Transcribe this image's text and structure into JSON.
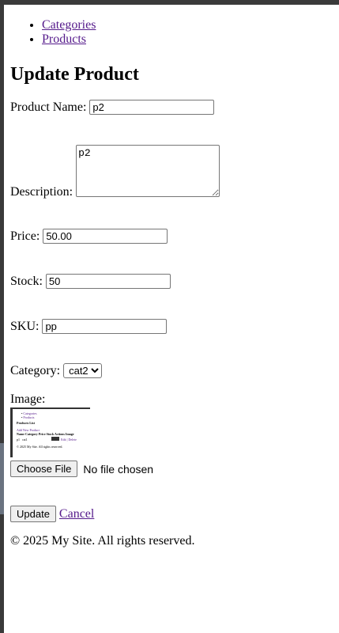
{
  "nav": {
    "items": [
      "Categories",
      "Products"
    ]
  },
  "form": {
    "title": "Update Product",
    "product_name": {
      "label": "Product Name:",
      "value": "p2"
    },
    "description": {
      "label": "Description:",
      "value": "p2"
    },
    "price": {
      "label": "Price:",
      "value": "50.00"
    },
    "stock": {
      "label": "Stock:",
      "value": "50"
    },
    "sku": {
      "label": "SKU:",
      "value": "pp"
    },
    "category": {
      "label": "Category:",
      "selected": "cat2"
    },
    "image": {
      "label": "Image:",
      "thumbnail": {
        "nav": [
          "Categories",
          "Products"
        ],
        "title": "Products List",
        "add_link": "Add New Product",
        "headers": [
          "Name",
          "Category",
          "Price",
          "Stock",
          "Actions",
          "Image"
        ],
        "row": [
          "p1",
          "cat1",
          "",
          "",
          "Edit | Delete"
        ],
        "footer": "© 2025 My Site. All rights reserved."
      },
      "choose_button": "Choose File",
      "file_status": "No file chosen"
    },
    "update_button": "Update",
    "cancel_link": "Cancel"
  },
  "footer": {
    "text": "© 2025 My Site. All rights reserved."
  }
}
